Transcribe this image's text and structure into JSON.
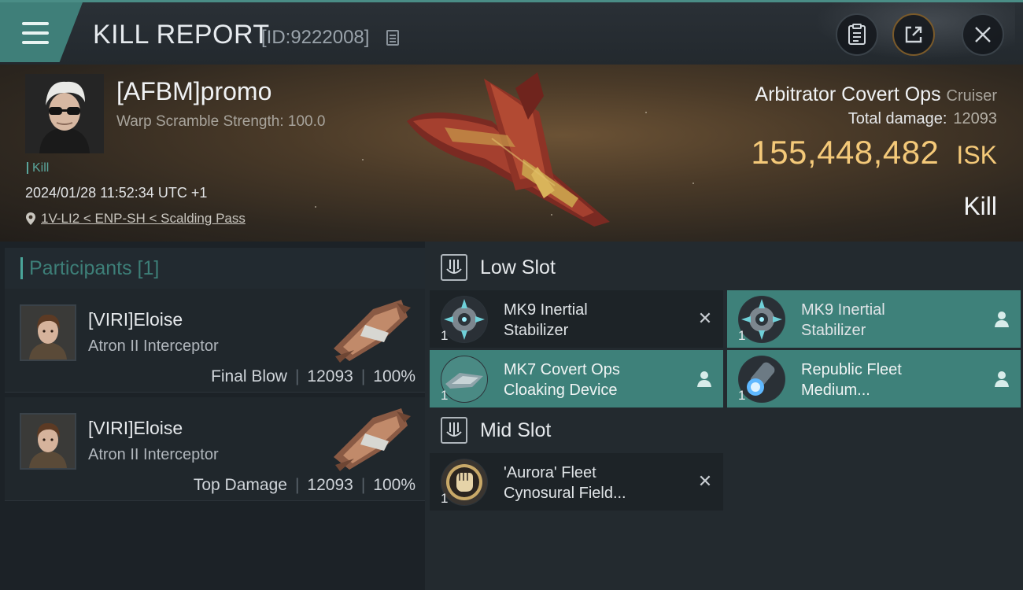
{
  "header": {
    "title": "KILL REPORT",
    "id_label": "[ID:9222008]"
  },
  "victim": {
    "name": "[AFBM]promo",
    "subtitle": "Warp Scramble Strength: 100.0",
    "tag": "Kill",
    "datetime": "2024/01/28 11:52:34 UTC +1",
    "location": "1V-LI2 < ENP-SH < Scalding Pass"
  },
  "ship": {
    "name": "Arbitrator Covert Ops",
    "class": "Cruiser",
    "damage_label": "Total damage:",
    "damage_value": "12093",
    "isk_value": "155,448,482",
    "isk_unit": "ISK",
    "kill_type": "Kill"
  },
  "participants": {
    "title": "Participants [1]",
    "items": [
      {
        "name": "[VIRI]Eloise",
        "ship": "Atron II Interceptor",
        "role": "Final Blow",
        "damage": "12093",
        "percent": "100%"
      },
      {
        "name": "[VIRI]Eloise",
        "ship": "Atron II Interceptor",
        "role": "Top Damage",
        "damage": "12093",
        "percent": "100%"
      }
    ]
  },
  "fittings": {
    "low_slot": {
      "title": "Low Slot",
      "modules": [
        {
          "qty": "1",
          "line1": "MK9 Inertial",
          "line2": "Stabilizer",
          "status": "destroyed"
        },
        {
          "qty": "1",
          "line1": "MK9 Inertial",
          "line2": "Stabilizer",
          "status": "dropped"
        },
        {
          "qty": "1",
          "line1": "MK7 Covert Ops",
          "line2": "Cloaking Device",
          "status": "dropped"
        },
        {
          "qty": "1",
          "line1": "Republic Fleet",
          "line2": "Medium...",
          "status": "dropped"
        }
      ]
    },
    "mid_slot": {
      "title": "Mid Slot",
      "modules": [
        {
          "qty": "1",
          "line1": "'Aurora' Fleet",
          "line2": "Cynosural Field...",
          "status": "destroyed"
        }
      ]
    }
  },
  "colors": {
    "accent_teal": "#3e817a",
    "isk_gold": "#f4c979",
    "panel_dark": "#1d2327"
  }
}
